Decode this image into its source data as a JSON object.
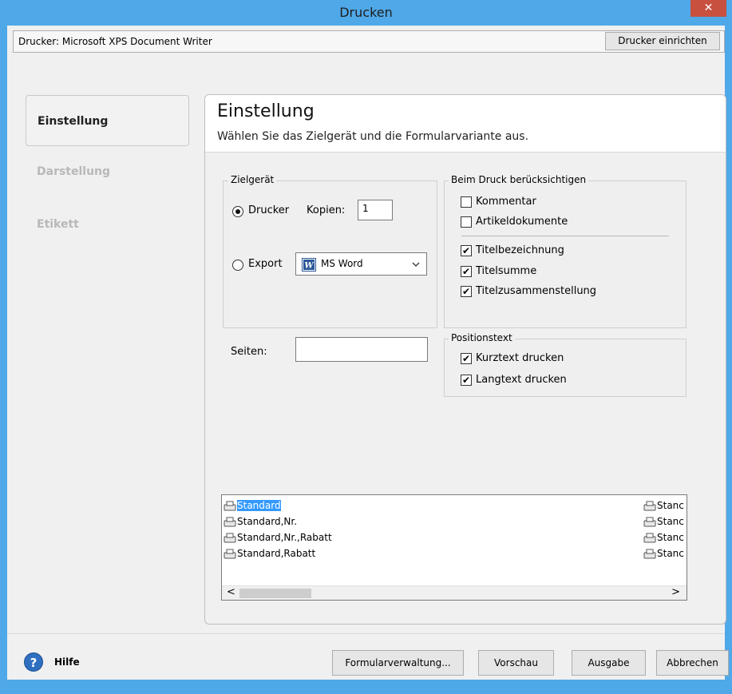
{
  "window": {
    "title": "Drucken",
    "close_glyph": "✕"
  },
  "printer_bar": {
    "label": "Drucker: Microsoft XPS Document Writer",
    "setup_button": "Drucker einrichten"
  },
  "sidebar": {
    "items": [
      {
        "label": "Einstellung",
        "active": true
      },
      {
        "label": "Darstellung",
        "active": false
      },
      {
        "label": "Etikett",
        "active": false
      }
    ]
  },
  "panel": {
    "title": "Einstellung",
    "subtitle": "Wählen Sie das Zielgerät und die Formularvariante aus."
  },
  "zielgeraet": {
    "legend": "Zielgerät",
    "printer_option": "Drucker",
    "copies_label": "Kopien:",
    "copies_value": "1",
    "export_option": "Export",
    "export_format": "MS Word",
    "export_icon": "word-icon"
  },
  "seiten": {
    "label": "Seiten:",
    "value": ""
  },
  "beim_druck": {
    "legend": "Beim Druck berücksichtigen",
    "items": [
      {
        "label": "Kommentar",
        "checked": false
      },
      {
        "label": "Artikeldokumente",
        "checked": false
      },
      {
        "label": "Titelbezeichnung",
        "checked": true
      },
      {
        "label": "Titelsumme",
        "checked": true
      },
      {
        "label": "Titelzusammenstellung",
        "checked": true
      }
    ]
  },
  "positionstext": {
    "legend": "Positionstext",
    "items": [
      {
        "label": "Kurztext drucken",
        "checked": true
      },
      {
        "label": "Langtext drucken",
        "checked": true
      }
    ]
  },
  "form_list": {
    "items": [
      "Standard",
      "Standard,Nr.",
      "Standard,Nr.,Rabatt",
      "Standard,Rabatt"
    ],
    "selected": "Standard",
    "right_column": [
      "Stanc",
      "Stanc",
      "Stanc",
      "Stanc"
    ],
    "scroll_left": "<",
    "scroll_right": ">"
  },
  "footer": {
    "help_glyph": "?",
    "help_label": "Hilfe",
    "buttons": [
      "Formularverwaltung...",
      "Vorschau",
      "Ausgabe",
      "Abbrechen"
    ]
  },
  "colors": {
    "titlebar": "#4fa8e8",
    "close": "#c7503f",
    "selection": "#3399ff"
  }
}
